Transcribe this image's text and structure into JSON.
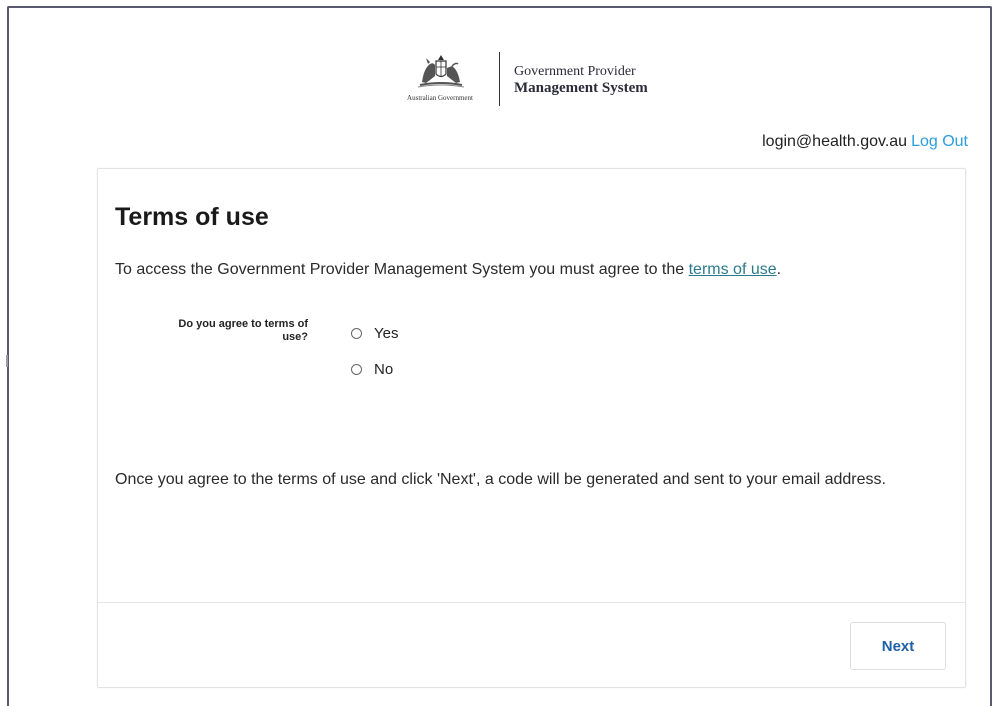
{
  "header": {
    "government_name": "Australian Government",
    "system_line1": "Government Provider",
    "system_line2": "Management System"
  },
  "user_bar": {
    "email": "login@health.gov.au",
    "logout_label": "Log Out",
    "link_color": "#2a9de0"
  },
  "card": {
    "title": "Terms of use",
    "intro_prefix": "To access the Government Provider Management System you must agree to the ",
    "terms_link_label": "terms of use",
    "intro_suffix": ".",
    "question_label": "Do you agree to terms of use?",
    "options": [
      {
        "label": "Yes",
        "selected": false
      },
      {
        "label": "No",
        "selected": false
      }
    ],
    "info_text": "Once you agree to the terms of use and click 'Next', a code will be generated and sent to your email address.",
    "next_label": "Next"
  },
  "icons": {
    "crest": "commonwealth-coat-of-arms-icon",
    "radio": "radio-unchecked-icon"
  },
  "colors": {
    "link_teal": "#2b7a8c",
    "button_text": "#1f5fa8",
    "frame_border": "#5a5a6e"
  }
}
